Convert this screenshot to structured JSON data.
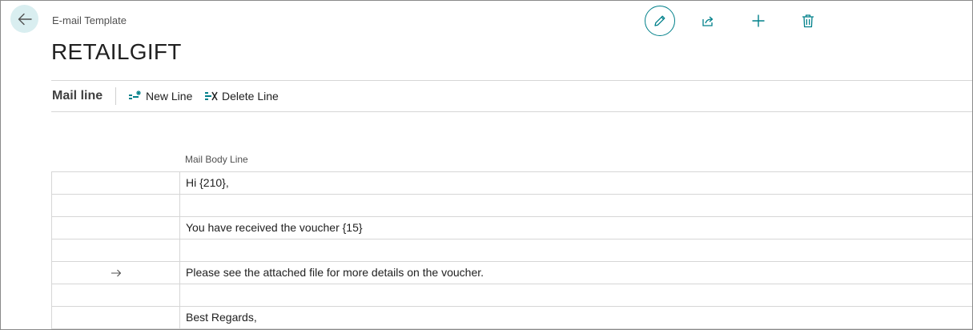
{
  "header": {
    "entity_type": "E-mail Template",
    "record_title": "RETAILGIFT"
  },
  "colors": {
    "accent": "#00808a",
    "back_button_bg": "#d9eef0"
  },
  "header_actions": [
    {
      "name": "edit",
      "icon": "pencil-icon"
    },
    {
      "name": "share",
      "icon": "share-icon"
    },
    {
      "name": "new",
      "icon": "plus-icon"
    },
    {
      "name": "delete",
      "icon": "trash-icon"
    }
  ],
  "part": {
    "title": "Mail line",
    "actions": {
      "new_line": "New Line",
      "delete_line": "Delete Line"
    },
    "column_header": "Mail Body Line"
  },
  "rows": [
    {
      "text": "Hi {210},",
      "indicator": ""
    },
    {
      "text": "",
      "indicator": ""
    },
    {
      "text": "You have received the voucher {15}",
      "indicator": ""
    },
    {
      "text": "",
      "indicator": ""
    },
    {
      "text": "Please see the attached file for more details on the voucher.",
      "indicator": "arrow-right-icon"
    },
    {
      "text": "",
      "indicator": ""
    },
    {
      "text": "Best Regards,",
      "indicator": ""
    }
  ]
}
